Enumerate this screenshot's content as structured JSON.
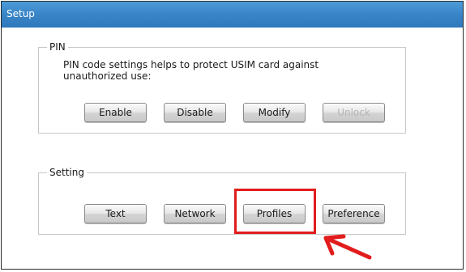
{
  "window": {
    "title": "Setup"
  },
  "pin_group": {
    "legend": "PIN",
    "description": "PIN code settings helps to protect  USIM card against unauthorized  use:",
    "buttons": [
      {
        "label": "Enable",
        "enabled": true
      },
      {
        "label": "Disable",
        "enabled": true
      },
      {
        "label": "Modify",
        "enabled": true
      },
      {
        "label": "Unlock",
        "enabled": false
      }
    ]
  },
  "setting_group": {
    "legend": "Setting",
    "buttons": [
      {
        "label": "Text"
      },
      {
        "label": "Network"
      },
      {
        "label": "Profiles"
      },
      {
        "label": "Preference"
      }
    ]
  },
  "annotation": {
    "highlight_color": "#e21c1c",
    "highlighted_button": "Profiles"
  }
}
